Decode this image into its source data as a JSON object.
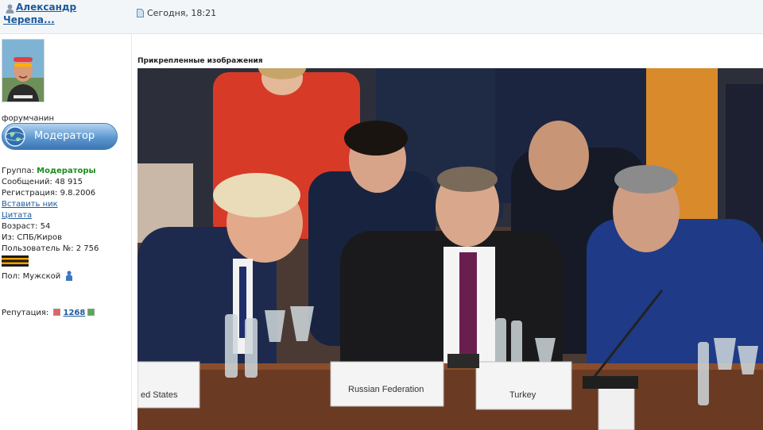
{
  "post": {
    "author_name": "Александр Черепа...",
    "date": "Сегодня, 18:21"
  },
  "sidebar": {
    "rank_title": "форумчанин",
    "badge_label": "Модератор",
    "group_label": "Группа:",
    "group_value": "Модераторы",
    "messages": "Сообщений: 48 915",
    "registration": "Регистрация: 9.8.2006",
    "insert_nick": "Вставить ник",
    "quote": "Цитата",
    "age": "Возраст: 54",
    "location": "Из: СПБ/Киров",
    "user_number": "Пользователь №: 2 756",
    "gender": "Пол: Мужской",
    "reputation_label": "Репутация:",
    "reputation_value": "1268"
  },
  "attachments": {
    "title": "Прикрепленные изображения",
    "nameplates": [
      "ed States",
      "Russian Federation",
      "Turkey"
    ]
  },
  "colors": {
    "link": "#1c5a9b",
    "group": "#1d8a1d",
    "badge": "#5d98cf"
  },
  "icons": [
    "user-icon",
    "document-icon",
    "globe-icon",
    "gender-icon",
    "reputation-minus-icon",
    "reputation-plus-icon"
  ]
}
